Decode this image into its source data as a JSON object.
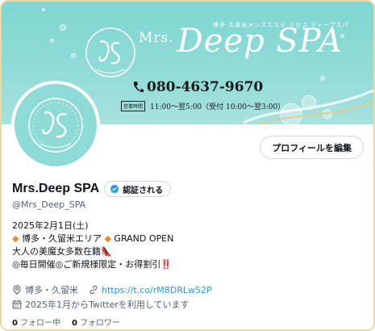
{
  "banner": {
    "brand_prefix": "Mrs.",
    "brand_name": "Deep SPA",
    "tagline": "博多 久留米メンズエステ ミセス ディープスパ",
    "phone": "080-4637-9670",
    "hours_badge": "営業時間",
    "hours": "11:00〜翌5:00（受付 10:00〜翌3:00）"
  },
  "profile": {
    "display_name": "Mrs.Deep SPA",
    "verify_label": "認証される",
    "handle": "@Mrs_Deep_SPA",
    "edit_button": "プロフィールを編集"
  },
  "bio": {
    "line1": "2025年2月1日(土)",
    "line2_a": "◆",
    "line2_b": " 博多・久留米エリア ",
    "line2_c": "◆",
    "line2_d": " GRAND OPEN",
    "line3_text": "大人の美魔女多数在籍",
    "line3_emoji": "👠",
    "line4_text": "◎毎日開催◎ご新規様限定・お得割引",
    "line4_emoji": "‼️"
  },
  "meta": {
    "location": "博多・久留米",
    "url": "https://t.co/rM8DRLw52P",
    "joined": "2025年1月からTwitterを利用しています"
  },
  "stats": {
    "following_count": "0",
    "following_label": "フォロー中",
    "followers_count": "0",
    "followers_label": "フォロワー"
  },
  "colors": {
    "banner": "#8ddad6",
    "link": "#1d9bf0",
    "frame": "#e8d9a8",
    "verified": "#1d9bf0"
  }
}
